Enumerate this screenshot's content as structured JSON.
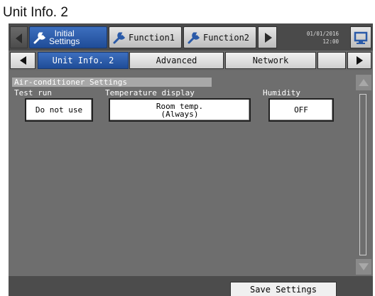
{
  "page_title": "Unit Info. 2",
  "header": {
    "tabs": [
      {
        "label_line1": "Initial",
        "label_line2": "Settings",
        "icon": "wrench-icon",
        "active": true
      },
      {
        "label": "Function1",
        "icon": "wrench-icon",
        "active": false
      },
      {
        "label": "Function2",
        "icon": "wrench-icon",
        "active": false
      }
    ],
    "date": "01/01/2016",
    "time": "12:00",
    "monitor_icon": "monitor-icon"
  },
  "sub_tabs": [
    {
      "label": "Unit Info. 2",
      "active": true
    },
    {
      "label": "Advanced",
      "active": false
    },
    {
      "label": "Network",
      "active": false
    },
    {
      "label": "",
      "active": false
    }
  ],
  "section": {
    "title": "Air-conditioner Settings",
    "fields": {
      "test_run": {
        "label": "Test run",
        "value": "Do not use"
      },
      "temperature_display": {
        "label": "Temperature display",
        "value_line1": "Room temp.",
        "value_line2": "(Always)"
      },
      "humidity": {
        "label": "Humidity",
        "value": "OFF"
      }
    }
  },
  "footer": {
    "save_label": "Save Settings"
  },
  "colors": {
    "active_tab": "#2a5aa8",
    "background": "#6e6e6e"
  }
}
